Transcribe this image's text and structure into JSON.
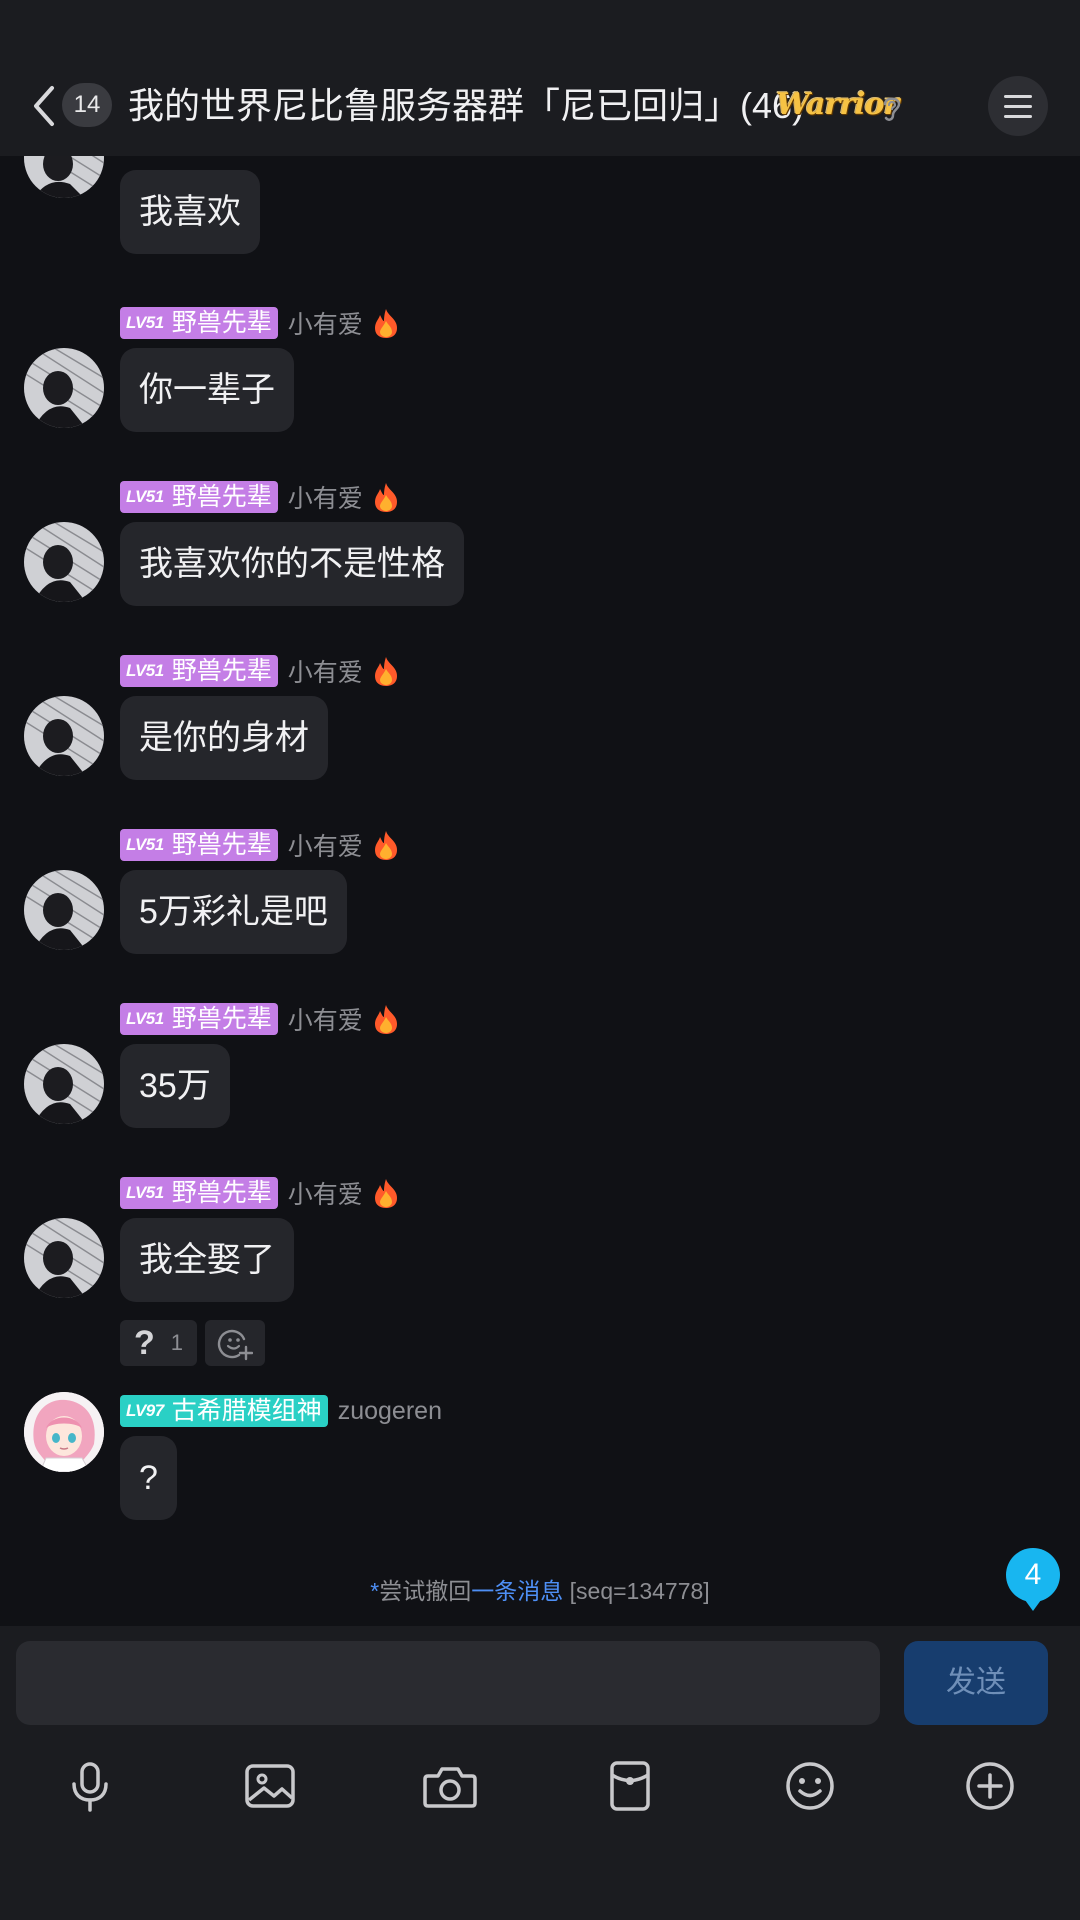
{
  "header": {
    "unread_count": "14",
    "title": "我的世界尼比鲁服务器群「尼已回归」(46)",
    "badge_text": "Warrior"
  },
  "messages": [
    {
      "text": "我喜欢"
    },
    {
      "level": "LV51",
      "title_tag": "野兽先辈",
      "nick": "小有爱",
      "text": "你一辈子"
    },
    {
      "level": "LV51",
      "title_tag": "野兽先辈",
      "nick": "小有爱",
      "text": "我喜欢你的不是性格"
    },
    {
      "level": "LV51",
      "title_tag": "野兽先辈",
      "nick": "小有爱",
      "text": "是你的身材"
    },
    {
      "level": "LV51",
      "title_tag": "野兽先辈",
      "nick": "小有爱",
      "text": "5万彩礼是吧"
    },
    {
      "level": "LV51",
      "title_tag": "野兽先辈",
      "nick": "小有爱",
      "text": "35万"
    },
    {
      "level": "LV51",
      "title_tag": "野兽先辈",
      "nick": "小有爱",
      "text": "我全娶了"
    },
    {
      "level": "LV97",
      "title_tag": "古希腊模组神",
      "nick": "zuogeren",
      "text": "?"
    }
  ],
  "reaction": {
    "glyph": "?",
    "count": "1"
  },
  "system_notice": {
    "star": "*",
    "prefix": "尝试撤回",
    "link": "一条消息",
    "suffix": " [seq=134778]"
  },
  "new_message_count": "4",
  "input": {
    "value": "",
    "placeholder": "",
    "send_label": "发送"
  },
  "toolbar_icons": [
    "microphone-icon",
    "image-icon",
    "camera-icon",
    "red-packet-icon",
    "emoji-icon",
    "plus-icon"
  ],
  "colors": {
    "background": "#101115",
    "bar": "#1b1c20",
    "bubble": "#25262b",
    "tag_purple": "#c47ee6",
    "tag_teal": "#2ad0c5",
    "accent_blue": "#4e8ff5",
    "badge_blue": "#18b6f0",
    "send_button": "#173d6e"
  }
}
